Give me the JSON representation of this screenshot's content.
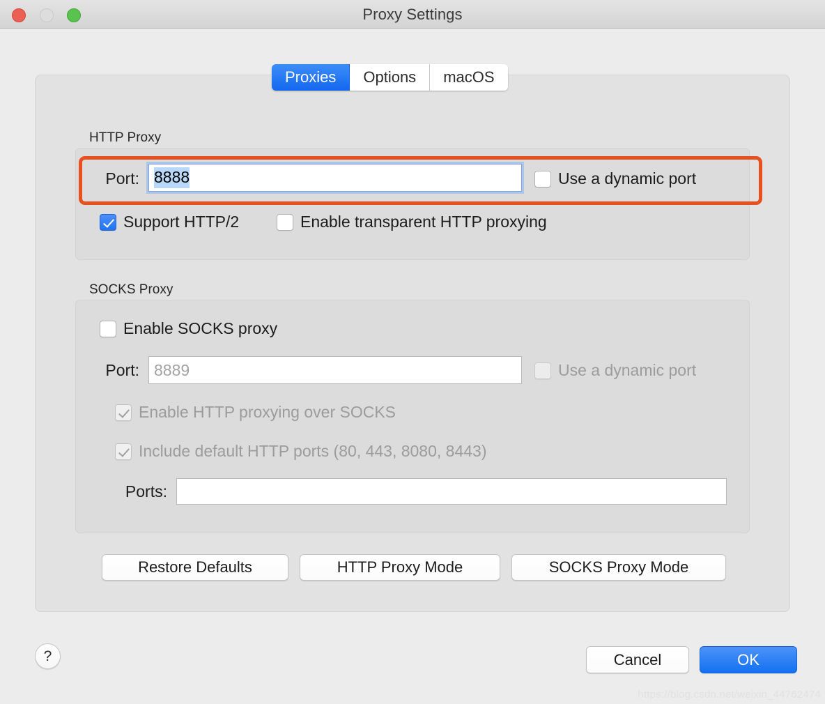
{
  "window": {
    "title": "Proxy Settings",
    "traffic_lights": [
      {
        "name": "close",
        "color": "#ea6055"
      },
      {
        "name": "minimize",
        "color": "#dddddd"
      },
      {
        "name": "maximize",
        "color": "#5ac24f"
      }
    ]
  },
  "tabs": [
    {
      "label": "Proxies",
      "active": true
    },
    {
      "label": "Options",
      "active": false
    },
    {
      "label": "macOS",
      "active": false
    }
  ],
  "http_proxy": {
    "group_label": "HTTP Proxy",
    "port_label": "Port:",
    "port_value": "8888",
    "port_focused": true,
    "port_selected": true,
    "dynamic_port_label": "Use a dynamic port",
    "dynamic_port_checked": false,
    "support_http2_label": "Support HTTP/2",
    "support_http2_checked": true,
    "transparent_label": "Enable transparent HTTP proxying",
    "transparent_checked": false
  },
  "socks_proxy": {
    "group_label": "SOCKS Proxy",
    "enable_label": "Enable SOCKS proxy",
    "enable_checked": false,
    "port_label": "Port:",
    "port_placeholder": "8889",
    "dynamic_port_label": "Use a dynamic port",
    "dynamic_port_checked": false,
    "http_over_socks_label": "Enable HTTP proxying over SOCKS",
    "http_over_socks_checked": true,
    "default_ports_label": "Include default HTTP ports (80, 443, 8080, 8443)",
    "default_ports_checked": true,
    "ports_label": "Ports:",
    "ports_value": ""
  },
  "action_buttons": {
    "restore_defaults": "Restore Defaults",
    "http_proxy_mode": "HTTP Proxy Mode",
    "socks_proxy_mode": "SOCKS Proxy Mode"
  },
  "footer": {
    "help": "?",
    "cancel": "Cancel",
    "ok": "OK"
  },
  "annotation": {
    "color": "#e8511f"
  },
  "watermark": "https://blog.csdn.net/weixin_44762474"
}
